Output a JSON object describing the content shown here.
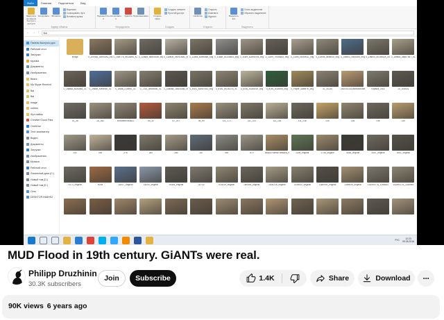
{
  "video": {
    "explorer": {
      "ribbon_tabs": [
        "Файл",
        "Главная",
        "Поделиться",
        "Вид"
      ],
      "ribbon_buttons": [
        "Закрепить на панели быстрого доступа",
        "Копировать",
        "Вставить",
        "Переместить в",
        "Копировать в",
        "Удалить",
        "Переименовать",
        "Создать папку",
        "Свойства",
        "Выделить все"
      ],
      "ribbon_small": [
        "Вырезать",
        "Скопировать путь",
        "Вставить ярлык",
        "Создать элемент",
        "Простой доступ",
        "Открыть",
        "Изменить",
        "Журнал",
        "Снять выделение",
        "Обратить выделение"
      ],
      "ribbon_groups": [
        "Буфер обмена",
        "Упорядочить",
        "Создать",
        "Открыть",
        "Выделить"
      ],
      "address_path": "Bal",
      "nav_items": [
        {
          "label": "Панель быстрого дос",
          "color": "#4a90d9",
          "selected": true
        },
        {
          "label": "Рабочий стол",
          "color": "#3c7fc8"
        },
        {
          "label": "Загрузки",
          "color": "#3c7fc8"
        },
        {
          "label": "музыка",
          "color": "#e0a93b"
        },
        {
          "label": "Документы",
          "color": "#6f8fb5"
        },
        {
          "label": "Изображения",
          "color": "#6f8fb5"
        },
        {
          "label": "Bears",
          "color": "#e0c35a"
        },
        {
          "label": "My Skype Receivd",
          "color": "#e0c35a"
        },
        {
          "label": "Bal",
          "color": "#e0c35a"
        },
        {
          "label": "Bal",
          "color": "#e0c35a"
        },
        {
          "label": "image",
          "color": "#e0c35a"
        },
        {
          "label": "голень",
          "color": "#e0c35a"
        },
        {
          "label": "Фул-тайпы",
          "color": "#e0c35a"
        },
        {
          "label": "Creative Cloud Files",
          "color": "#d9534f"
        },
        {
          "label": "OneDrive",
          "color": "#2b7cd3"
        },
        {
          "label": "Этот компьютер",
          "color": "#5a8fc8"
        },
        {
          "label": "Видео",
          "color": "#6f8fb5"
        },
        {
          "label": "Документы",
          "color": "#6f8fb5"
        },
        {
          "label": "Загрузки",
          "color": "#3c7fc8"
        },
        {
          "label": "Изображения",
          "color": "#6f8fb5"
        },
        {
          "label": "Музыка",
          "color": "#6f8fb5"
        },
        {
          "label": "Рабочий стол",
          "color": "#3c7fc8"
        },
        {
          "label": "Локальный диск (C:)",
          "color": "#7a8a99"
        },
        {
          "label": "Новый том (D:)",
          "color": "#7a8a99"
        },
        {
          "label": "Новый том (E:)",
          "color": "#7a8a99"
        },
        {
          "label": "Сеть",
          "color": "#5a8fc8"
        },
        {
          "label": "DESKTOP-HA8HS2",
          "color": "#5a8fc8"
        }
      ],
      "rows": [
        [
          {
            "name": "image",
            "color": "#d8b05a"
          },
          {
            "name": "0_10e5a2_dcf940a1_orig",
            "color": "#8a7760"
          },
          {
            "name": "0_1f5e778_5e24ab5_XL",
            "color": "#a39985"
          },
          {
            "name": "0_11f8ad_bad992ab_orig",
            "color": "#6f6a64"
          },
          {
            "name": "0_118e0e_5e092656_orig",
            "color": "#b7b0a2"
          },
          {
            "name": "0_118ba_83ebbaf8_orig",
            "color": "#7b7466"
          },
          {
            "name": "0_118ae_a21c8a05_orig",
            "color": "#8f8f8d"
          },
          {
            "name": "0_118f9_a2a9a7ed_orig",
            "color": "#9d9585"
          },
          {
            "name": "0_118f9_7bdb8a3f_orig",
            "color": "#656058"
          },
          {
            "name": "0_118f9_ce1f5e02_orig",
            "color": "#a79f8e"
          },
          {
            "name": "0_11f69a_ab5fb36_orig",
            "color": "#8e8978"
          },
          {
            "name": "0_1fab63_0af30fd5_orig",
            "color": "#4f6b88"
          },
          {
            "name": "0_1fab63_8c1e6d2e_orig",
            "color": "#7c776b"
          },
          {
            "name": "0_1fab6a_4ad67b57_XL",
            "color": "#a69e8a"
          }
        ],
        [
          {
            "name": "0_1fab6a_a0a4dd8_XL",
            "color": "#6b6459"
          },
          {
            "name": "0_1f6ddf_f0e6e0fc_XL",
            "color": "#4f6e9a"
          },
          {
            "name": "0_1f6ab_216e50_XL",
            "color": "#9c9684"
          },
          {
            "name": "0_7201_abc5f6b5_XL",
            "color": "#847d70"
          },
          {
            "name": "0_15ada8_3a4040a5_orig",
            "color": "#5c5850"
          },
          {
            "name": "0_e1ff1_a1b87cd3_orig",
            "color": "#797366"
          },
          {
            "name": "0_e1ff1_fb10c27d_XL",
            "color": "#8d8575"
          },
          {
            "name": "0_e1ff1_fc2d5c1e_orig",
            "color": "#b9b29d"
          },
          {
            "name": "0_e1ff1_fc2d5bd_orig",
            "color": "#2f5e3c"
          },
          {
            "name": "0_Paper_4abbf7b_orig",
            "color": "#a08a5c"
          },
          {
            "name": "01_4c235",
            "color": "#8a8272"
          },
          {
            "name": "2a10010152b4b6a9cd5e0d_18",
            "color": "#b99a74"
          },
          {
            "name": "93pauls_0f16",
            "color": "#7f7a6d"
          },
          {
            "name": "10_20d401",
            "color": "#5e5a52"
          }
        ],
        [
          {
            "name": "20_36",
            "color": "#6f6c66"
          },
          {
            "name": "28_282",
            "color": "#9a9280"
          },
          {
            "name": "40b6d4ec94a811",
            "color": "#8f8677"
          },
          {
            "name": "55_32",
            "color": "#b15a3e"
          },
          {
            "name": "57_247",
            "color": "#8c8470"
          },
          {
            "name": "95_69",
            "color": "#a77a4c"
          },
          {
            "name": "111_172",
            "color": "#96907e"
          },
          {
            "name": "111_223",
            "color": "#7d7768"
          },
          {
            "name": "111_236",
            "color": "#b7ae96"
          },
          {
            "name": "111_238",
            "color": "#6c675e"
          },
          {
            "name": "235",
            "color": "#c4a269"
          },
          {
            "name": "236",
            "color": "#8e8470"
          },
          {
            "name": "238",
            "color": "#6d695f"
          },
          {
            "name": "239",
            "color": "#b89c70"
          }
        ],
        [
          {
            "name": "241",
            "color": "#a09a89"
          },
          {
            "name": "246",
            "color": "#c0b39b"
          },
          {
            "name": "276",
            "color": "#3b3a37"
          },
          {
            "name": "282",
            "color": "#7f796c"
          },
          {
            "name": "285",
            "color": "#a39b8a"
          },
          {
            "name": "287",
            "color": "#5f6b78"
          },
          {
            "name": "289",
            "color": "#8c8b85"
          },
          {
            "name": "872",
            "color": "#9a9688"
          },
          {
            "name": "885pc-Human-headed_Winged_Bull",
            "color": "#a88e66"
          },
          {
            "name": "1298_original",
            "color": "#5f7555"
          },
          {
            "name": "2738_original",
            "color": "#9a8a6c"
          },
          {
            "name": "2448_original",
            "color": "#3d3b35"
          },
          {
            "name": "3457_original",
            "color": "#6f6a60"
          },
          {
            "name": "4901_original",
            "color": "#55524a"
          }
        ],
        [
          {
            "name": "4173_original",
            "color": "#6d6a62"
          },
          {
            "name": "6008",
            "color": "#9c6a46"
          },
          {
            "name": "18017_original",
            "color": "#5a6f8c"
          },
          {
            "name": "18200_original",
            "color": "#8a97a8"
          },
          {
            "name": "19083_original",
            "color": "#5d5a54"
          },
          {
            "name": "32732",
            "color": "#7e7a70"
          },
          {
            "name": "014410_original",
            "color": "#8f8674"
          },
          {
            "name": "069038_original",
            "color": "#6b665c"
          },
          {
            "name": "1000228_original",
            "color": "#a49b85"
          },
          {
            "name": "1339532_original",
            "color": "#86806f"
          },
          {
            "name": "1380939_original",
            "color": "#545048"
          },
          {
            "name": "1366939_original",
            "color": "#a08f73"
          },
          {
            "name": "152494776_1166583",
            "color": "#7c776c"
          },
          {
            "name": "152494776_1166584",
            "color": "#8d8674"
          }
        ],
        [
          {
            "name": "",
            "color": "#8c6e50"
          },
          {
            "name": "",
            "color": "#7a5e44"
          },
          {
            "name": "",
            "color": "#a0866a"
          },
          {
            "name": "",
            "color": "#b3a07e"
          },
          {
            "name": "",
            "color": "#7d6a55"
          },
          {
            "name": "",
            "color": "#6c5d4d"
          },
          {
            "name": "",
            "color": "#9c8b72"
          },
          {
            "name": "",
            "color": "#8a7660"
          },
          {
            "name": "",
            "color": "#b09474"
          },
          {
            "name": "",
            "color": "#6f6251"
          },
          {
            "name": "",
            "color": "#a89677"
          },
          {
            "name": "",
            "color": "#8b7a62"
          },
          {
            "name": "",
            "color": "#5e5a50"
          },
          {
            "name": "",
            "color": "#a3927a"
          }
        ]
      ],
      "taskbar": {
        "apps": [
          {
            "icon": "windows-start-icon",
            "color": "#1979ca"
          },
          {
            "icon": "search-icon",
            "color": "#7a8796"
          },
          {
            "icon": "task-view-icon",
            "color": "#7a8796"
          },
          {
            "icon": "explorer-icon",
            "color": "#e3b341"
          },
          {
            "icon": "edge-icon",
            "color": "#2b7cd3"
          },
          {
            "icon": "chrome-icon",
            "color": "#db4437"
          },
          {
            "icon": "skype-icon",
            "color": "#00aff0"
          },
          {
            "icon": "photoshop-icon",
            "color": "#31a8ff"
          },
          {
            "icon": "media-icon",
            "color": "#f28b00"
          },
          {
            "icon": "word-icon",
            "color": "#2b579a"
          },
          {
            "icon": "folder-icon",
            "color": "#e3b341"
          }
        ],
        "language": "РУС",
        "time": "12:23",
        "date": "05.08.2016"
      }
    }
  },
  "title": "MUD Flood in 19th century. GiANTs were real.",
  "channel": {
    "name": "Philipp Druzhinin",
    "subscribers": "30.3K subscribers"
  },
  "buttons": {
    "join": "Join",
    "subscribe": "Subscribe",
    "likes": "1.4K",
    "share": "Share",
    "download": "Download",
    "more": "···"
  },
  "stats": {
    "views": "90K views",
    "age": "6 years ago"
  }
}
